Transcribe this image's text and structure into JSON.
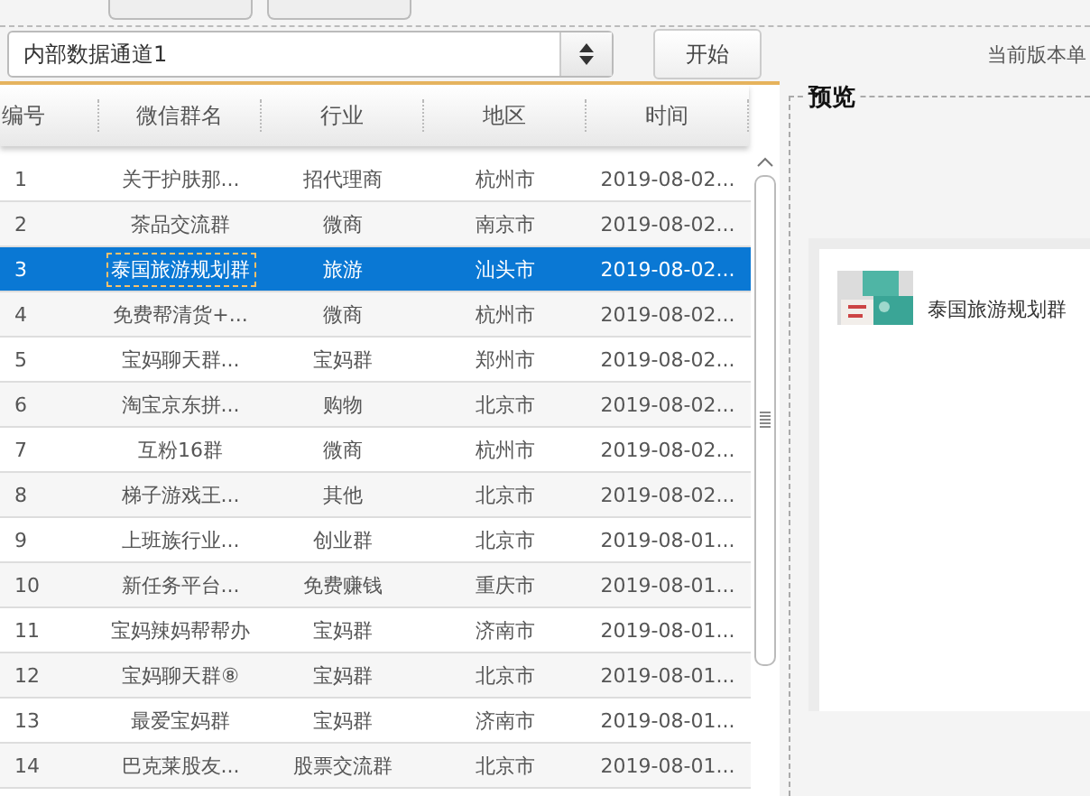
{
  "channel_select": {
    "value": "内部数据通道1"
  },
  "start_button": "开始",
  "version_text": "当前版本单",
  "table": {
    "columns": [
      "编号",
      "微信群名",
      "行业",
      "地区",
      "时间"
    ],
    "rows": [
      {
        "cells": [
          "1",
          "关于护肤那...",
          "招代理商",
          "杭州市",
          "2019-08-02..."
        ],
        "selected": false
      },
      {
        "cells": [
          "2",
          "茶品交流群",
          "微商",
          "南京市",
          "2019-08-02..."
        ],
        "selected": false
      },
      {
        "cells": [
          "3",
          "泰国旅游规划群",
          "旅游",
          "汕头市",
          "2019-08-02..."
        ],
        "selected": true
      },
      {
        "cells": [
          "4",
          "免费帮清货+...",
          "微商",
          "杭州市",
          "2019-08-02..."
        ],
        "selected": false
      },
      {
        "cells": [
          "5",
          "宝妈聊天群...",
          "宝妈群",
          "郑州市",
          "2019-08-02..."
        ],
        "selected": false
      },
      {
        "cells": [
          "6",
          "淘宝京东拼...",
          "购物",
          "北京市",
          "2019-08-02..."
        ],
        "selected": false
      },
      {
        "cells": [
          "7",
          "互粉16群",
          "微商",
          "杭州市",
          "2019-08-02..."
        ],
        "selected": false
      },
      {
        "cells": [
          "8",
          "梯子游戏王...",
          "其他",
          "北京市",
          "2019-08-02..."
        ],
        "selected": false
      },
      {
        "cells": [
          "9",
          "上班族行业...",
          "创业群",
          "北京市",
          "2019-08-01..."
        ],
        "selected": false
      },
      {
        "cells": [
          "10",
          "新任务平台...",
          "免费赚钱",
          "重庆市",
          "2019-08-01..."
        ],
        "selected": false
      },
      {
        "cells": [
          "11",
          "宝妈辣妈帮帮办",
          "宝妈群",
          "济南市",
          "2019-08-01..."
        ],
        "selected": false
      },
      {
        "cells": [
          "12",
          "宝妈聊天群⑧",
          "宝妈群",
          "北京市",
          "2019-08-01..."
        ],
        "selected": false
      },
      {
        "cells": [
          "13",
          "最爱宝妈群",
          "宝妈群",
          "济南市",
          "2019-08-01..."
        ],
        "selected": false
      },
      {
        "cells": [
          "14",
          "巴克莱股友...",
          "股票交流群",
          "北京市",
          "2019-08-01..."
        ],
        "selected": false
      }
    ]
  },
  "preview": {
    "title": "预览",
    "card": {
      "name": "泰国旅游规划群"
    }
  }
}
